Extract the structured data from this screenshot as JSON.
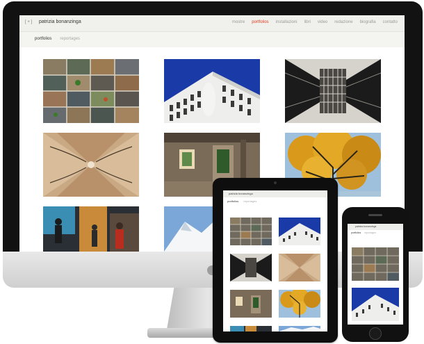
{
  "site": {
    "brand_mark": "[ + ]",
    "name": "patrizia bonanzinga",
    "nav": [
      "mostre",
      "portfolios",
      "installazioni",
      "libri",
      "video",
      "redazione",
      "biografia",
      "contatto"
    ],
    "active_nav": "portfolios"
  },
  "subnav": {
    "items": [
      "portfolios",
      "reportages"
    ],
    "active": "portfolios"
  },
  "gallery": [
    {
      "name": "aerial-patchwork-photo"
    },
    {
      "name": "palazzo-colosseo-quadrato-photo"
    },
    {
      "name": "geometric-tunnel-photo"
    },
    {
      "name": "symmetric-architecture-photo"
    },
    {
      "name": "ruined-interior-photo"
    },
    {
      "name": "autumn-tree-photo"
    },
    {
      "name": "street-people-photo"
    },
    {
      "name": "snowy-mountain-photo"
    }
  ],
  "tablet": {
    "name": "patrizia bonanzinga"
  },
  "phone": {
    "name": "patrizia bonanzinga"
  },
  "colors": {
    "accent": "#e03a1e",
    "header_bg": "#f0f0ec",
    "frame": "#121212"
  }
}
